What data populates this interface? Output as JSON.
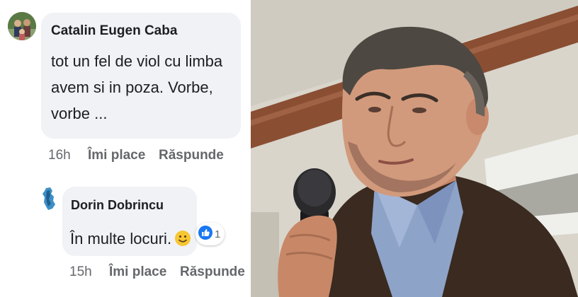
{
  "comments": [
    {
      "author": "Catalin Eugen Caba",
      "text_lines": [
        "tot un fel de viol cu limba",
        "avem si in poza. Vorbe,",
        "vorbe ..."
      ],
      "time": "16h",
      "like_label": "Îmi place",
      "reply_label": "Răspunde"
    }
  ],
  "reply": {
    "author": "Dorin Dobrincu",
    "text": "În multe locuri.",
    "emoji": "slightly-smiling-face-icon",
    "reaction_count": "1",
    "time": "15h",
    "like_label": "Îmi place",
    "reply_label": "Răspunde"
  },
  "colors": {
    "bubble": "#f0f2f5",
    "meta_text": "#65676b",
    "like_blue": "#1877f2"
  }
}
